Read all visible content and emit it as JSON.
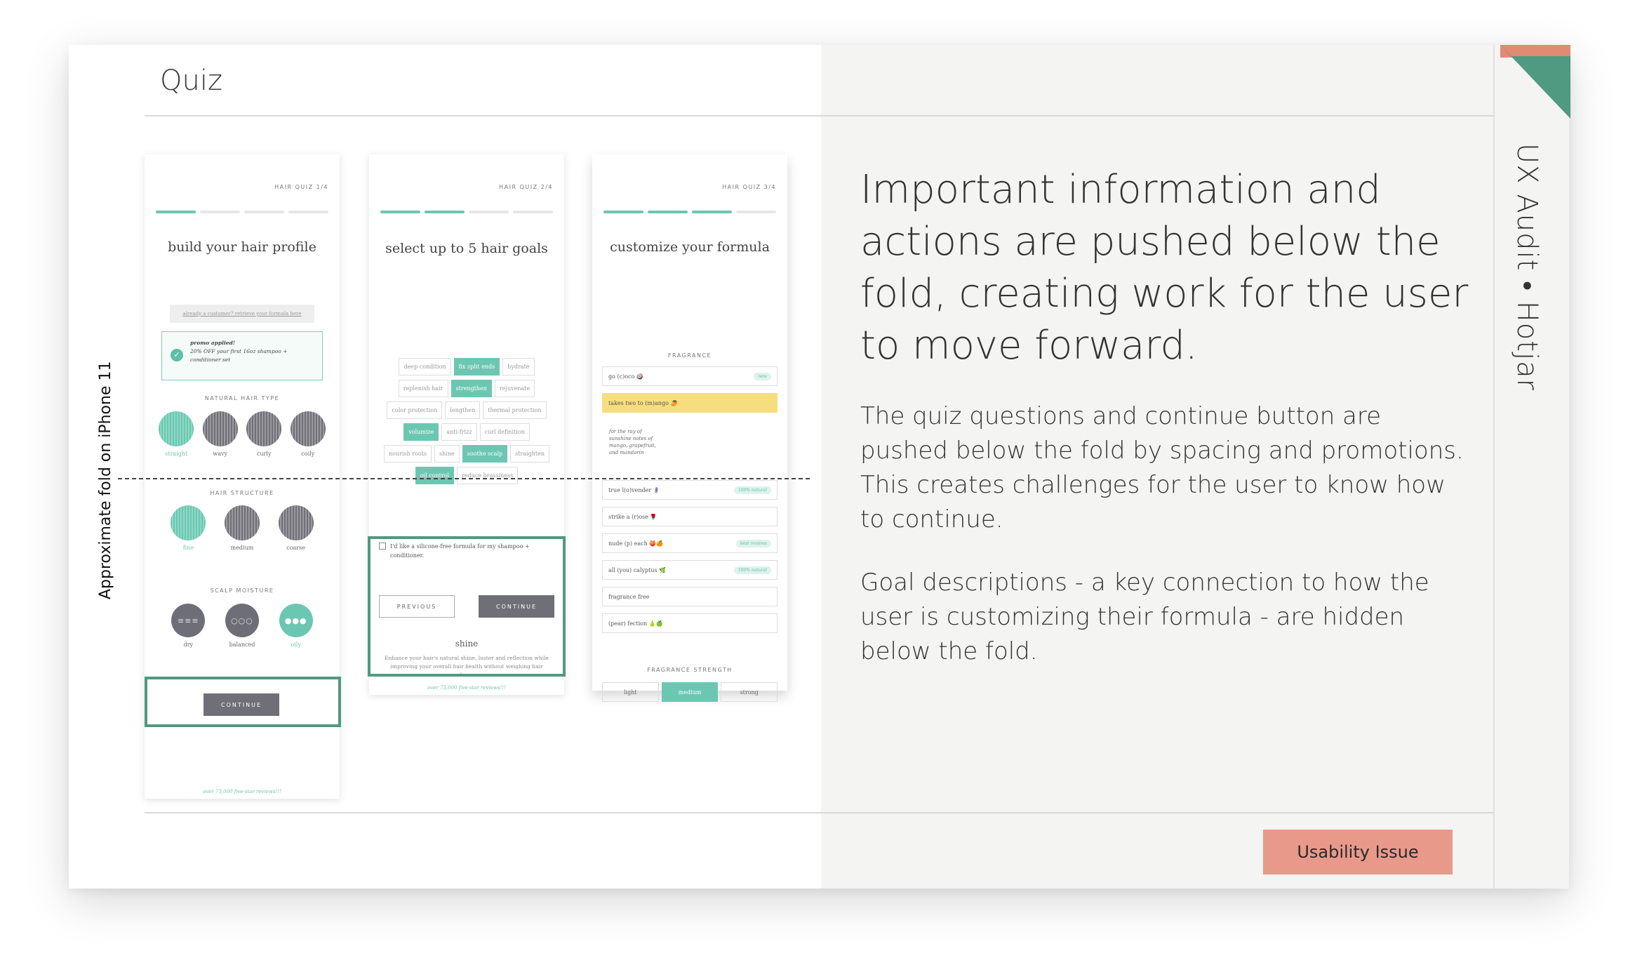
{
  "slide": {
    "title": "Quiz",
    "side_label": "UX Audit • Hotjar",
    "fold_label": "Approximate fold on iPhone 11",
    "headline": "Important information and actions are pushed below the fold, creating work for the user to move forward.",
    "paragraphs": [
      "The quiz questions and continue button are pushed below the fold by spacing and promotions. This creates challenges for the user to know how to continue.",
      "Goal descriptions - a key connection to how the user is customizing their formula - are hidden below the fold."
    ],
    "badge": "Usability Issue",
    "colors": {
      "accent_teal": "#6cc7b2",
      "highlight_green": "#4f9a80",
      "badge_salmon": "#e9998a",
      "corner_teal": "#4f9a80",
      "corner_salmon": "#e08b72"
    }
  },
  "screen1": {
    "quiz_header": "HAIR QUIZ 1/4",
    "progress": {
      "step": 1,
      "total": 4
    },
    "title": "build your hair profile",
    "retrieve_link": "already a customer? retrieve your formula here",
    "promo": {
      "title": "promo applied!",
      "text": "20% OFF your first 16oz shampoo + conditioner set"
    },
    "sections": [
      {
        "label": "NATURAL HAIR TYPE",
        "options": [
          {
            "label": "straight",
            "selected": true
          },
          {
            "label": "wavy",
            "selected": false
          },
          {
            "label": "curly",
            "selected": false
          },
          {
            "label": "coily",
            "selected": false
          }
        ]
      },
      {
        "label": "HAIR STRUCTURE",
        "options": [
          {
            "label": "fine",
            "selected": true
          },
          {
            "label": "medium",
            "selected": false
          },
          {
            "label": "coarse",
            "selected": false
          }
        ]
      },
      {
        "label": "SCALP MOISTURE",
        "options": [
          {
            "label": "dry",
            "selected": false,
            "glyph": "≡≡≡"
          },
          {
            "label": "balanced",
            "selected": false,
            "glyph": "○○○"
          },
          {
            "label": "oily",
            "selected": true,
            "glyph": "●●●"
          }
        ]
      }
    ],
    "continue": "CONTINUE",
    "reviews": "over 73,000 five-star reviews!!!"
  },
  "screen2": {
    "quiz_header": "HAIR QUIZ 2/4",
    "progress": {
      "step": 2,
      "total": 4
    },
    "title": "select up to 5 hair goals",
    "goals": [
      {
        "label": "deep condition",
        "selected": false
      },
      {
        "label": "fix split ends",
        "selected": true
      },
      {
        "label": "hydrate",
        "selected": false
      },
      {
        "label": "replenish hair",
        "selected": false
      },
      {
        "label": "strengthen",
        "selected": true
      },
      {
        "label": "rejuvenate",
        "selected": false
      },
      {
        "label": "color protection",
        "selected": false
      },
      {
        "label": "lengthen",
        "selected": false
      },
      {
        "label": "thermal protection",
        "selected": false
      },
      {
        "label": "volumize",
        "selected": true
      },
      {
        "label": "anti-frizz",
        "selected": false
      },
      {
        "label": "curl definition",
        "selected": false
      },
      {
        "label": "nourish roots",
        "selected": false
      },
      {
        "label": "shine",
        "selected": false
      },
      {
        "label": "soothe scalp",
        "selected": true
      },
      {
        "label": "straighten",
        "selected": false
      },
      {
        "label": "oil control",
        "selected": true
      },
      {
        "label": "reduce brassiness",
        "selected": false
      }
    ],
    "checkbox": "I'd like a silicone-free formula for my shampoo + conditioner.",
    "previous": "PREVIOUS",
    "continue": "CONTINUE",
    "goal_title": "shine",
    "goal_desc": "Enhance your hair's natural shine, luster and reflection while improving your overall hair health without weighing hair down.",
    "reviews": "over 73,000 five-star reviews!!!"
  },
  "screen3": {
    "quiz_header": "HAIR QUIZ 3/4",
    "progress": {
      "step": 3,
      "total": 4
    },
    "title": "customize your formula",
    "fragrance_label": "FRAGRANCE",
    "fragrances": [
      {
        "label": "go (c)oco 🥥",
        "tag": "new",
        "highlight": false
      },
      {
        "label": "takes two to (m)ango 🥭",
        "tag": "",
        "highlight": true
      },
      {
        "label": "true l(o)vender 🪻",
        "tag": "100% natural",
        "highlight": false
      },
      {
        "label": "strike a (r)ose 🌹",
        "tag": "",
        "highlight": false
      },
      {
        "label": "nude (p) each 🍑🍊",
        "tag": "best reviews",
        "highlight": false
      },
      {
        "label": "all (you) calyptus 🌿",
        "tag": "100% natural",
        "highlight": false
      },
      {
        "label": "fragrance free",
        "tag": "",
        "highlight": false
      },
      {
        "label": "(pear) fection 🍐🍏",
        "tag": "",
        "highlight": false
      }
    ],
    "mango_desc": "for the ray of sunshine notes of mango, grapefruit, and mandarin",
    "strength_label": "FRAGRANCE STRENGTH",
    "strengths": [
      {
        "label": "light",
        "selected": false
      },
      {
        "label": "medium",
        "selected": true
      },
      {
        "label": "strong",
        "selected": false
      }
    ]
  }
}
